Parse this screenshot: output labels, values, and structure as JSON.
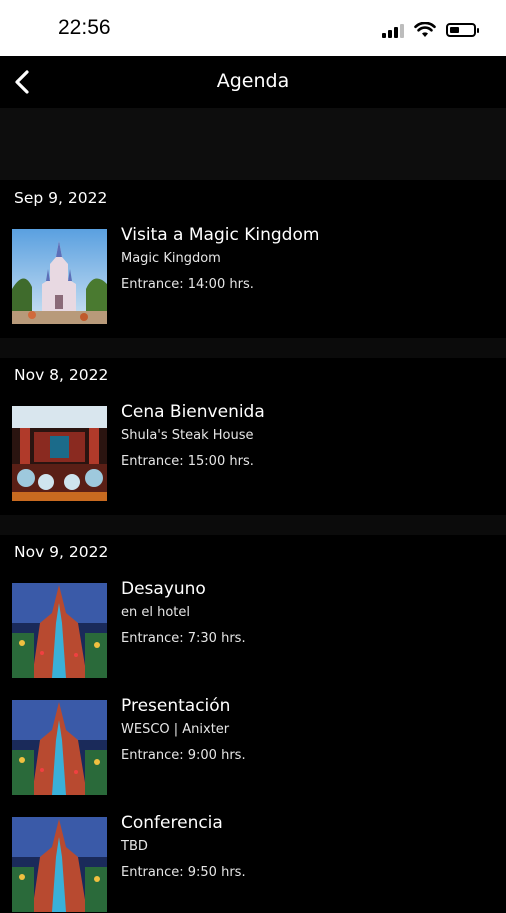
{
  "status_bar": {
    "time": "22:56"
  },
  "nav": {
    "title": "Agenda"
  },
  "sections": [
    {
      "date": "Sep 9, 2022",
      "events": [
        {
          "title": "Visita a Magic Kingdom",
          "subtitle": "Magic Kingdom",
          "entrance": "Entrance: 14:00 hrs."
        }
      ]
    },
    {
      "date": "Nov 8, 2022",
      "events": [
        {
          "title": "Cena Bienvenida",
          "subtitle": "Shula's Steak House",
          "entrance": "Entrance: 15:00 hrs."
        }
      ]
    },
    {
      "date": "Nov 9, 2022",
      "events": [
        {
          "title": "Desayuno",
          "subtitle": "en el hotel",
          "entrance": "Entrance: 7:30 hrs."
        },
        {
          "title": "Presentación",
          "subtitle": "WESCO | Anixter",
          "entrance": "Entrance: 9:00 hrs."
        },
        {
          "title": "Conferencia",
          "subtitle": "TBD",
          "entrance": "Entrance: 9:50 hrs."
        }
      ]
    }
  ]
}
